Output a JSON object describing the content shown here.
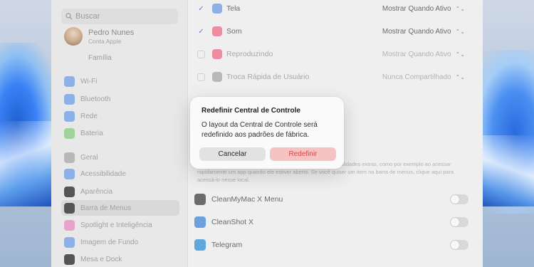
{
  "sidebar": {
    "search_placeholder": "Buscar",
    "user": {
      "name": "Pedro Nunes",
      "subtitle": "Conta Apple"
    },
    "family_label": "Família",
    "items": [
      {
        "label": "Wi-Fi",
        "icon": "wifi-icon",
        "color": "#8db0e6"
      },
      {
        "label": "Bluetooth",
        "icon": "bluetooth-icon",
        "color": "#8db0e6"
      },
      {
        "label": "Rede",
        "icon": "globe-icon",
        "color": "#8db0e6"
      },
      {
        "label": "Bateria",
        "icon": "battery-icon",
        "color": "#9fd39a"
      },
      {
        "label": "Geral",
        "icon": "gear-icon",
        "color": "#b8b8b8"
      },
      {
        "label": "Acessibilidade",
        "icon": "accessibility-icon",
        "color": "#8db0e6"
      },
      {
        "label": "Aparência",
        "icon": "appearance-icon",
        "color": "#555555"
      },
      {
        "label": "Barra de Menus",
        "icon": "menubar-icon",
        "color": "#555555"
      },
      {
        "label": "Spotlight e Inteligência",
        "icon": "spotlight-icon",
        "color": "#e8a3c8"
      },
      {
        "label": "Imagem de Fundo",
        "icon": "wallpaper-icon",
        "color": "#8db0e6"
      },
      {
        "label": "Mesa e Dock",
        "icon": "dock-icon",
        "color": "#555555"
      }
    ]
  },
  "controls": [
    {
      "label": "Tela",
      "value": "Mostrar Quando Ativo",
      "checked": true,
      "icon": "display-icon",
      "color": "#8db0e6"
    },
    {
      "label": "Som",
      "value": "Mostrar Quando Ativo",
      "checked": true,
      "icon": "sound-icon",
      "color": "#f08aa0"
    },
    {
      "label": "Reproduzindo",
      "value": "Mostrar Quando Ativo",
      "checked": false,
      "icon": "play-icon",
      "color": "#f08aa0"
    },
    {
      "label": "Troca Rápida de Usuário",
      "value": "Nunca Compartilhado",
      "checked": false,
      "icon": "user-switch-icon",
      "color": "#b8b8b8"
    }
  ],
  "description": "Estes itens da barra de menus servem para fornecer funcionalidades extras, como por exemplo ao acessar rapidamente um app quando ele estiver aberto. Se você quiser um item na barra de menus, clique aqui para acessá-lo nesse local.",
  "apps": [
    {
      "label": "CleanMyMac X Menu",
      "icon": "cleanmymac-icon",
      "color": "#6c6c6c"
    },
    {
      "label": "CleanShot X",
      "icon": "cleanshot-icon",
      "color": "#6fa0de"
    },
    {
      "label": "Telegram",
      "icon": "telegram-icon",
      "color": "#5fa8dd"
    }
  ],
  "dialog": {
    "title": "Redefinir Central de Controle",
    "message": "O layout da Central de Controle será redefinido aos padrões de fábrica.",
    "cancel_label": "Cancelar",
    "reset_label": "Redefinir"
  }
}
